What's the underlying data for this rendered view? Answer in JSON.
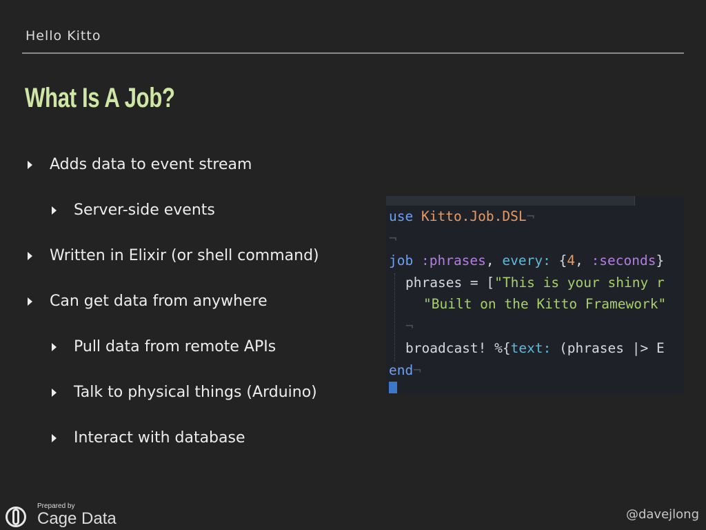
{
  "header": {
    "title": "Hello Kitto"
  },
  "slide": {
    "title": "What Is A Job?",
    "bullets": [
      {
        "text": "Adds data to event stream",
        "level": 1
      },
      {
        "text": "Server-side events",
        "level": 2
      },
      {
        "text": "Written in Elixir (or shell command)",
        "level": 1
      },
      {
        "text": "Can get data from anywhere",
        "level": 1
      },
      {
        "text": "Pull data from remote APIs",
        "level": 2
      },
      {
        "text": "Talk to physical things (Arduino)",
        "level": 2
      },
      {
        "text": "Interact with database",
        "level": 2
      }
    ]
  },
  "code": {
    "line1": {
      "kw": "use",
      "mod": "Kitto.Job.DSL",
      "eol": "¬"
    },
    "line2": {
      "eol": "¬"
    },
    "line3": {
      "kw": "job",
      "atom": ":phrases",
      "sep": ", ",
      "key": "every:",
      "open": " {",
      "num": "4",
      "comma": ", ",
      "atom2": ":seconds",
      "close": "}"
    },
    "line4": {
      "plain1": "phrases = [",
      "str": "\"This is your shiny r"
    },
    "line5": {
      "str": "\"Built on the Kitto Framework\""
    },
    "line6": {
      "eol": "¬"
    },
    "line7": {
      "plain1": "broadcast! %{",
      "key": "text:",
      "plain2": " (phrases |> E"
    },
    "line8": {
      "kw": "end",
      "eol": "¬"
    }
  },
  "footer": {
    "logo_small": "Prepared by",
    "logo_big": "Cage Data",
    "handle": "@davejlong"
  },
  "colors": {
    "background": "#232323",
    "title": "#cfe7a4",
    "code_background": "#1e2228"
  }
}
